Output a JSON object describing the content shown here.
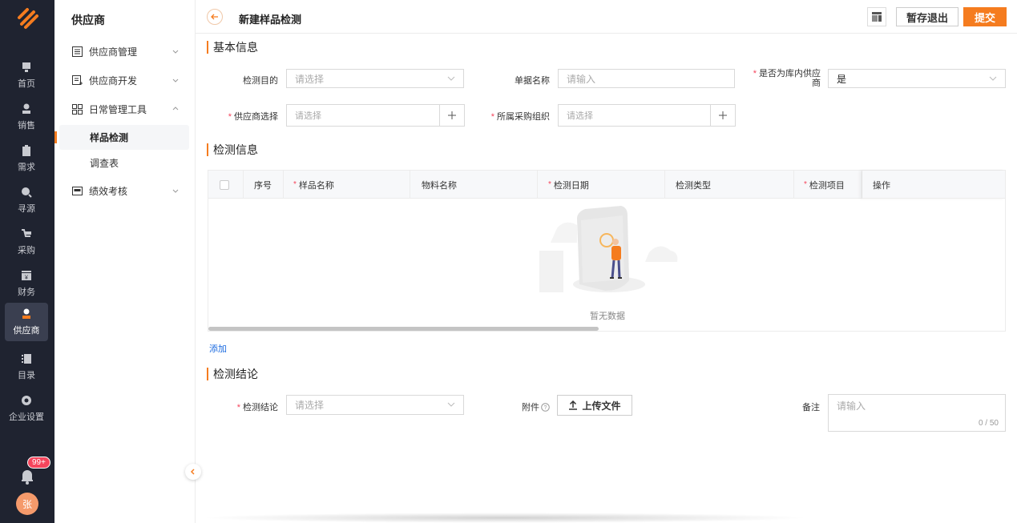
{
  "rail": {
    "items": [
      {
        "label": "首页",
        "icon": "home-icon"
      },
      {
        "label": "销售",
        "icon": "sales-icon"
      },
      {
        "label": "需求",
        "icon": "demand-icon"
      },
      {
        "label": "寻源",
        "icon": "sourcing-icon"
      },
      {
        "label": "采购",
        "icon": "cart-icon"
      },
      {
        "label": "财务",
        "icon": "finance-icon"
      },
      {
        "label": "供应商",
        "icon": "supplier-icon"
      },
      {
        "label": "目录",
        "icon": "catalog-icon"
      },
      {
        "label": "企业设置",
        "icon": "settings-icon"
      }
    ],
    "active_index": 6,
    "notification_count": "99+",
    "avatar_text": "张"
  },
  "sidebar": {
    "title": "供应商",
    "menu": [
      {
        "label": "供应商管理",
        "icon": "list-icon"
      },
      {
        "label": "供应商开发",
        "icon": "develop-icon"
      },
      {
        "label": "日常管理工具",
        "icon": "grid-icon"
      }
    ],
    "sub_items": [
      "样品检测",
      "调查表"
    ],
    "last_menu": {
      "label": "绩效考核",
      "icon": "performance-icon"
    }
  },
  "header": {
    "title": "新建样品检测",
    "save_label": "暂存退出",
    "submit_label": "提交"
  },
  "basic": {
    "title": "基本信息",
    "purpose_label": "检测目的",
    "purpose_placeholder": "请选择",
    "doc_name_label": "单据名称",
    "doc_name_placeholder": "请输入",
    "in_lib_label_1": "是否为库内供应",
    "in_lib_label_2": "商",
    "in_lib_value": "是",
    "supplier_label": "供应商选择",
    "supplier_placeholder": "请选择",
    "org_label": "所属采购组织",
    "org_placeholder": "请选择"
  },
  "detection": {
    "title": "检测信息",
    "columns": [
      "序号",
      "样品名称",
      "物料名称",
      "检测日期",
      "检测类型",
      "检测项目",
      "操作"
    ],
    "empty_text": "暂无数据",
    "add_label": "添加"
  },
  "conclusion": {
    "title": "检测结论",
    "result_label": "检测结论",
    "result_placeholder": "请选择",
    "attach_label": "附件",
    "upload_label": "上传文件",
    "remark_label": "备注",
    "remark_placeholder": "请输入",
    "counter": "0 / 50"
  },
  "colors": {
    "accent": "#f57c1f",
    "rail_bg": "#1f2330",
    "link": "#1a6ae0",
    "required": "#f5455c"
  }
}
